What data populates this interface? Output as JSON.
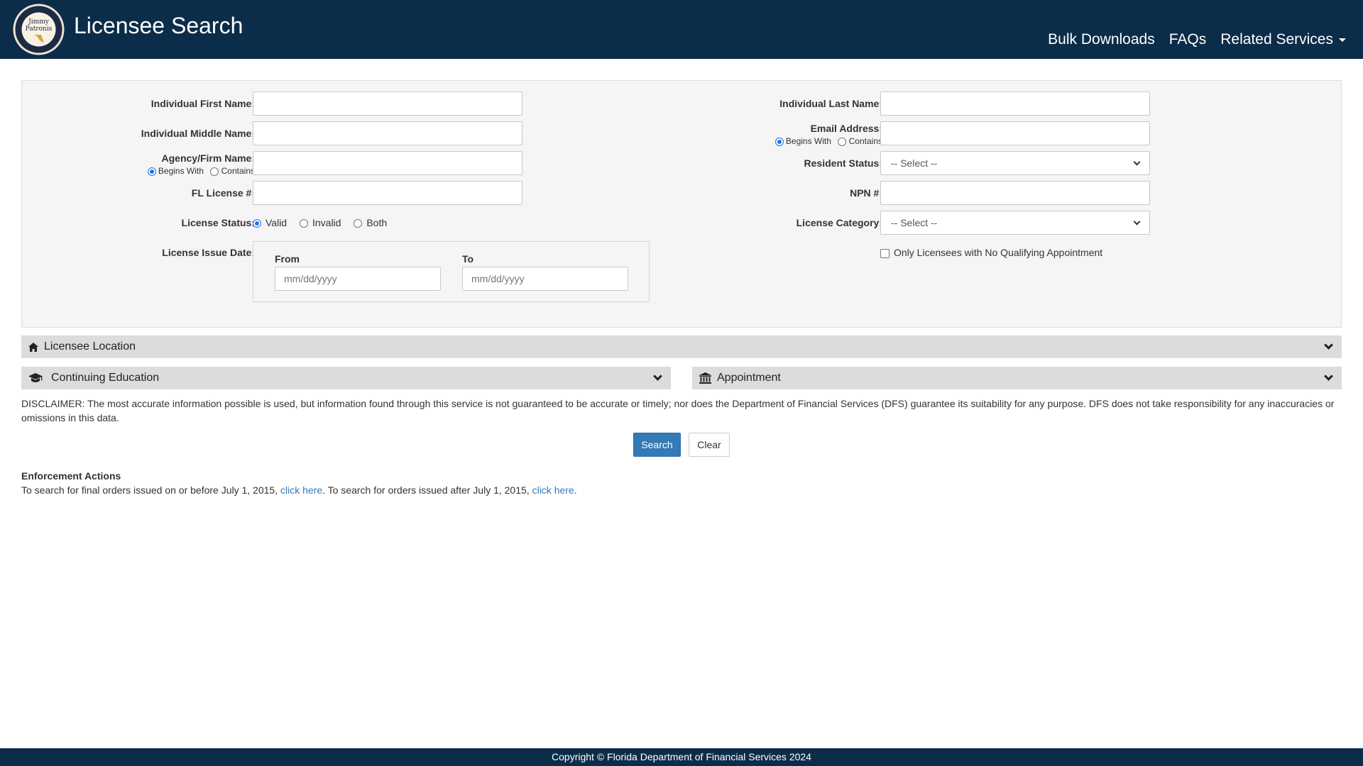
{
  "header": {
    "seal_text": "Jimmy Patronis",
    "title": "Licensee Search",
    "nav": {
      "bulk_downloads": "Bulk Downloads",
      "faqs": "FAQs",
      "related_services": "Related Services"
    }
  },
  "form": {
    "first_name": {
      "label": "Individual First Name:",
      "value": ""
    },
    "middle_name": {
      "label": "Individual Middle Name:",
      "value": ""
    },
    "agency": {
      "label": "Agency/Firm Name:",
      "value": "",
      "opt_begins": "Begins With",
      "opt_contains": "Contains",
      "selected": "Begins With"
    },
    "fl_license": {
      "label": "FL License #:",
      "value": ""
    },
    "license_status": {
      "label": "License Status:",
      "options": [
        "Valid",
        "Invalid",
        "Both"
      ],
      "selected": "Valid"
    },
    "issue_date": {
      "label": "License Issue Date:",
      "from_label": "From",
      "to_label": "To",
      "from_placeholder": "mm/dd/yyyy",
      "to_placeholder": "mm/dd/yyyy"
    },
    "last_name": {
      "label": "Individual Last Name:",
      "value": ""
    },
    "email": {
      "label": "Email Address:",
      "value": "",
      "opt_begins": "Begins With",
      "opt_contains": "Contains",
      "selected": "Begins With"
    },
    "resident_status": {
      "label": "Resident Status:",
      "selected": "-- Select --"
    },
    "npn": {
      "label": "NPN #:",
      "value": ""
    },
    "license_category": {
      "label": "License Category:",
      "selected": "-- Select --"
    },
    "no_appointment": {
      "label": "Only Licensees with No Qualifying Appointment",
      "checked": false
    }
  },
  "sections": {
    "location": "Licensee Location",
    "continuing_education": "Continuing Education",
    "appointment": "Appointment"
  },
  "disclaimer": "DISCLAIMER: The most accurate information possible is used, but information found through this service is not guaranteed to be accurate or timely; nor does the Department of Financial Services (DFS) guarantee its suitability for any purpose. DFS does not take responsibility for any inaccuracies or omissions in this data.",
  "buttons": {
    "search": "Search",
    "clear": "Clear"
  },
  "enforcement": {
    "title": "Enforcement Actions",
    "text_1": "To search for final orders issued on or before July 1, 2015, ",
    "link_1": "click here",
    "text_2": ". To search for orders issued after July 1, 2015, ",
    "link_2": "click here",
    "text_3": "."
  },
  "footer": "Copyright © Florida Department of Financial Services 2024",
  "colors": {
    "header_bg": "#0b2d49",
    "primary_button": "#337ab7",
    "link": "#337ab7",
    "section_bar": "#dcdcdc"
  }
}
